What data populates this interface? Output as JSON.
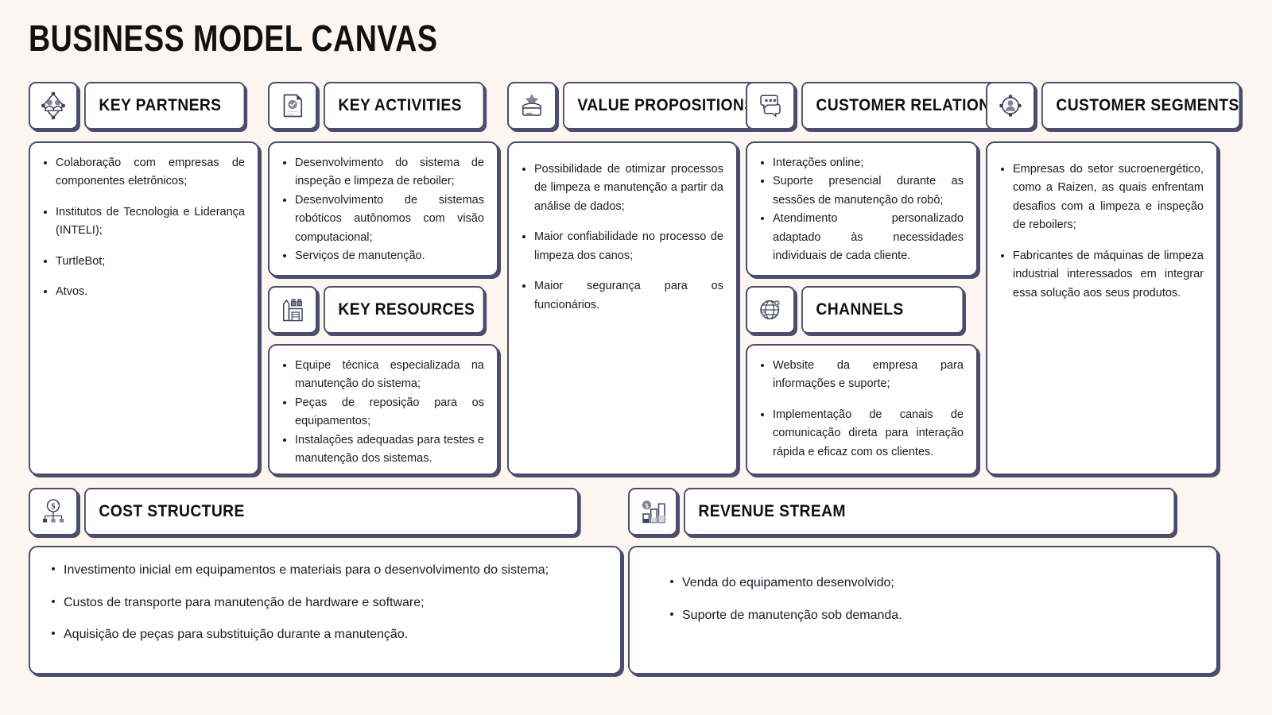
{
  "page": {
    "title": "BUSINESS MODEL CANVAS",
    "background_color": "#fcf5f0",
    "border_color": "#4a4d6b",
    "panel_color": "#ffffff",
    "icon_accent_color": "#8a8398"
  },
  "blocks": {
    "key_partners": {
      "title": "KEY PARTNERS",
      "icon": "partners-network-icon",
      "items": [
        "Colaboração com empresas de componentes eletrônicos;",
        "Institutos de Tecnologia e Liderança (INTELI);",
        "TurtleBot;",
        "Atvos."
      ]
    },
    "key_activities": {
      "title": "KEY ACTIVITIES",
      "icon": "document-check-icon",
      "items": [
        "Desenvolvimento do sistema de inspeção e limpeza de reboiler;",
        "Desenvolvimento de sistemas robóticos autônomos com visão computacional;",
        "Serviços de manutenção."
      ]
    },
    "key_resources": {
      "title": "KEY RESOURCES",
      "icon": "factory-icon",
      "items": [
        "Equipe técnica especializada na manutenção do sistema;",
        "Peças de reposição para os equipamentos;",
        "Instalações adequadas para testes e manutenção dos sistemas."
      ]
    },
    "value_propositions": {
      "title": "VALUE PROPOSITIONS",
      "icon": "gift-box-star-icon",
      "items": [
        "Possibilidade de otimizar processos de limpeza e manutenção a partir da análise de dados;",
        "Maior confiabilidade no processo de limpeza dos canos;",
        "Maior segurança para os funcionários."
      ]
    },
    "customer_relationship": {
      "title": "CUSTOMER RELATIONSHIP",
      "icon": "chat-bubbles-icon",
      "items": [
        "Interações online;",
        "Suporte presencial durante as sessões de manutenção do robô;",
        "Atendimento personalizado adaptado às necessidades individuais de cada cliente."
      ]
    },
    "channels": {
      "title": "CHANNELS",
      "icon": "globe-pins-icon",
      "items": [
        "Website da empresa para informações e suporte;",
        "Implementação de canais de comunicação direta para interação rápida e eficaz com os clientes."
      ]
    },
    "customer_segments": {
      "title": "CUSTOMER SEGMENTS",
      "icon": "user-target-icon",
      "items": [
        "Empresas do setor sucroenergético, como a Raizen, as quais enfrentam desafios com a limpeza e inspeção de reboilers;",
        "Fabricantes de máquinas de limpeza industrial interessados em integrar essa solução aos seus produtos."
      ]
    },
    "cost_structure": {
      "title": "COST STRUCTURE",
      "icon": "cost-hierarchy-icon",
      "items": [
        "Investimento inicial em equipamentos e materiais para o desenvolvimento do sistema;",
        "Custos de transporte para manutenção de hardware e software;",
        "Aquisição de peças para substituição durante a manutenção."
      ]
    },
    "revenue_stream": {
      "title": "REVENUE STREAM",
      "icon": "revenue-bar-chart-icon",
      "items": [
        "Venda do equipamento desenvolvido;",
        "Suporte de manutenção sob demanda."
      ]
    }
  }
}
